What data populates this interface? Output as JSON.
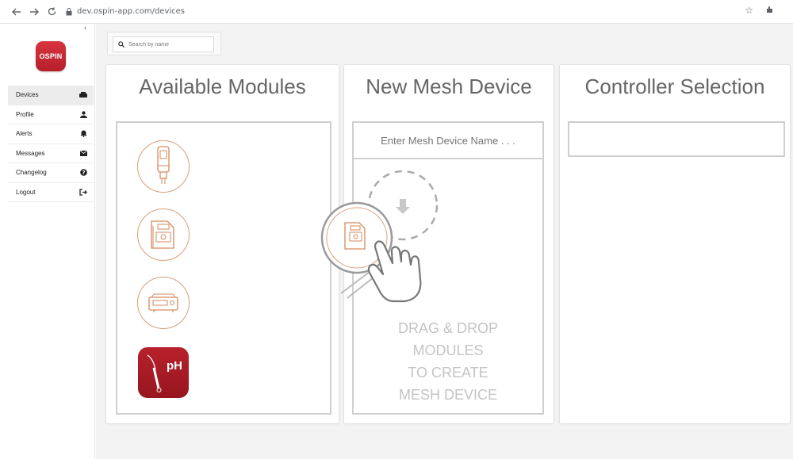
{
  "browser": {
    "url": "dev.ospin-app.com/devices",
    "back_icon": "arrow-left-icon",
    "forward_icon": "arrow-right-icon",
    "reload_icon": "reload-icon"
  },
  "sidebar": {
    "logo_text": "OSPIN",
    "collapse_glyph": "‹",
    "items": [
      {
        "label": "Devices",
        "icon": "devices-icon",
        "active": true
      },
      {
        "label": "Profile",
        "icon": "user-icon",
        "active": false
      },
      {
        "label": "Alerts",
        "icon": "bell-icon",
        "active": false
      },
      {
        "label": "Messages",
        "icon": "envelope-icon",
        "active": false
      },
      {
        "label": "Changelog",
        "icon": "question-circle-icon",
        "active": false
      },
      {
        "label": "Logout",
        "icon": "logout-icon",
        "active": false
      }
    ]
  },
  "search": {
    "placeholder": "Search by name"
  },
  "panels": {
    "available": {
      "title": "Available Modules"
    },
    "mesh": {
      "title": "New Mesh Device",
      "name_placeholder": "Enter Mesh Device Name . . .",
      "drop_lines": [
        "DRAG & DROP",
        "MODULES",
        "TO CREATE",
        "MESH DEVICE"
      ]
    },
    "controller": {
      "title": "Controller Selection"
    }
  },
  "modules": [
    {
      "name": "sensor-probe-module"
    },
    {
      "name": "pump-module"
    },
    {
      "name": "heater-module"
    },
    {
      "name": "ph-module",
      "label": "pH"
    }
  ],
  "colors": {
    "brand_red": "#c1222c",
    "module_outline": "#d8a07a",
    "border_gray": "#cfcfcf"
  }
}
